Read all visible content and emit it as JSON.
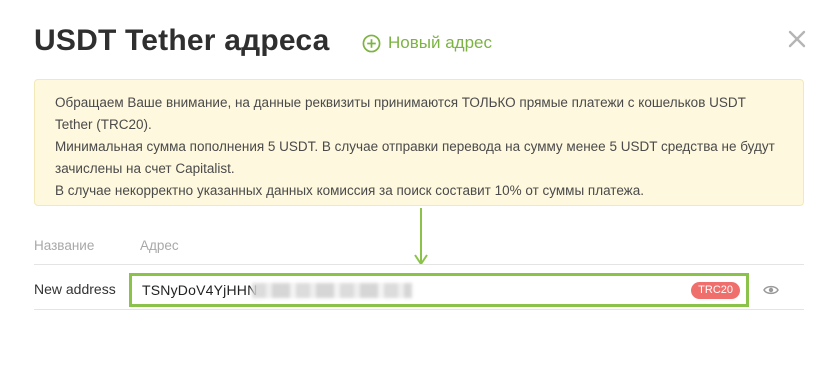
{
  "modal": {
    "title": "USDT Tether адреса",
    "new_address_label": "Новый адрес",
    "close_icon": "close-icon"
  },
  "notice": {
    "line1": "Обращаем Ваше внимание, на данные реквизиты принимаются ТОЛЬКО прямые платежи с кошельков USDT Tether (TRC20).",
    "line2": "Минимальная сумма пополнения 5 USDT. В случае отправки перевода на сумму менее 5 USDT средства не будут зачислены на счет Capitalist.",
    "line3": "В случае некорректно указанных данных комиссия за поиск составит 10% от суммы платежа."
  },
  "table": {
    "headers": {
      "name": "Название",
      "address": "Адрес"
    },
    "rows": [
      {
        "name": "New address",
        "address": "TSNyDoV4YjHHN",
        "network": "TRC20"
      }
    ]
  },
  "colors": {
    "accent_green": "#7cb342",
    "highlight_border": "#8bc34a",
    "notice_bg": "#fdf8de",
    "badge_red": "#ef6f6c"
  }
}
